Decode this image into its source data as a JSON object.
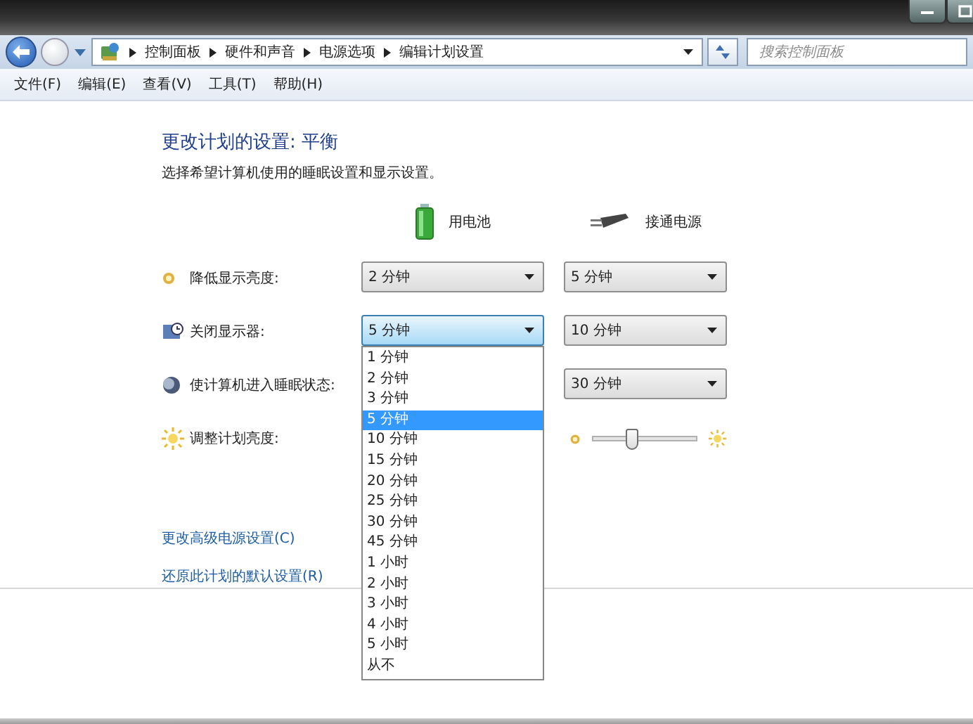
{
  "address_bar": {
    "breadcrumbs": [
      "控制面板",
      "硬件和声音",
      "电源选项",
      "编辑计划设置"
    ],
    "search": {
      "placeholder": "搜索控制面板"
    }
  },
  "menu": [
    "文件(F)",
    "编辑(E)",
    "查看(V)",
    "工具(T)",
    "帮助(H)"
  ],
  "heading": "更改计划的设置: 平衡",
  "subtitle": "选择希望计算机使用的睡眠设置和显示设置。",
  "columns": [
    {
      "label": "用电池",
      "kind": "battery"
    },
    {
      "label": "接通电源",
      "kind": "plug"
    }
  ],
  "settings": [
    {
      "kind": "dim",
      "label": "降低显示亮度:",
      "battery": {
        "value": "2 分钟",
        "open": false
      },
      "plugged": {
        "value": "5 分钟"
      }
    },
    {
      "kind": "display",
      "label": "关闭显示器:",
      "battery": {
        "value": "5 分钟",
        "open": true
      },
      "plugged": {
        "value": "10 分钟"
      }
    },
    {
      "kind": "sleep",
      "label": "使计算机进入睡眠状态:",
      "plugged": {
        "value": "30 分钟"
      }
    },
    {
      "kind": "brightness",
      "label": "调整计划亮度:",
      "plugged": {
        "level": 0.38
      }
    }
  ],
  "dropdown_options": [
    {
      "label": "1 分钟",
      "selected": false
    },
    {
      "label": "2 分钟",
      "selected": false
    },
    {
      "label": "3 分钟",
      "selected": false
    },
    {
      "label": "5 分钟",
      "selected": true
    },
    {
      "label": "10 分钟",
      "selected": false
    },
    {
      "label": "15 分钟",
      "selected": false
    },
    {
      "label": "20 分钟",
      "selected": false
    },
    {
      "label": "25 分钟",
      "selected": false
    },
    {
      "label": "30 分钟",
      "selected": false
    },
    {
      "label": "45 分钟",
      "selected": false
    },
    {
      "label": "1 小时",
      "selected": false
    },
    {
      "label": "2 小时",
      "selected": false
    },
    {
      "label": "3 小时",
      "selected": false
    },
    {
      "label": "4 小时",
      "selected": false
    },
    {
      "label": "5 小时",
      "selected": false
    },
    {
      "label": "从不",
      "selected": false
    }
  ],
  "links": [
    "更改高级电源设置(C)",
    "还原此计划的默认设置(R)"
  ]
}
